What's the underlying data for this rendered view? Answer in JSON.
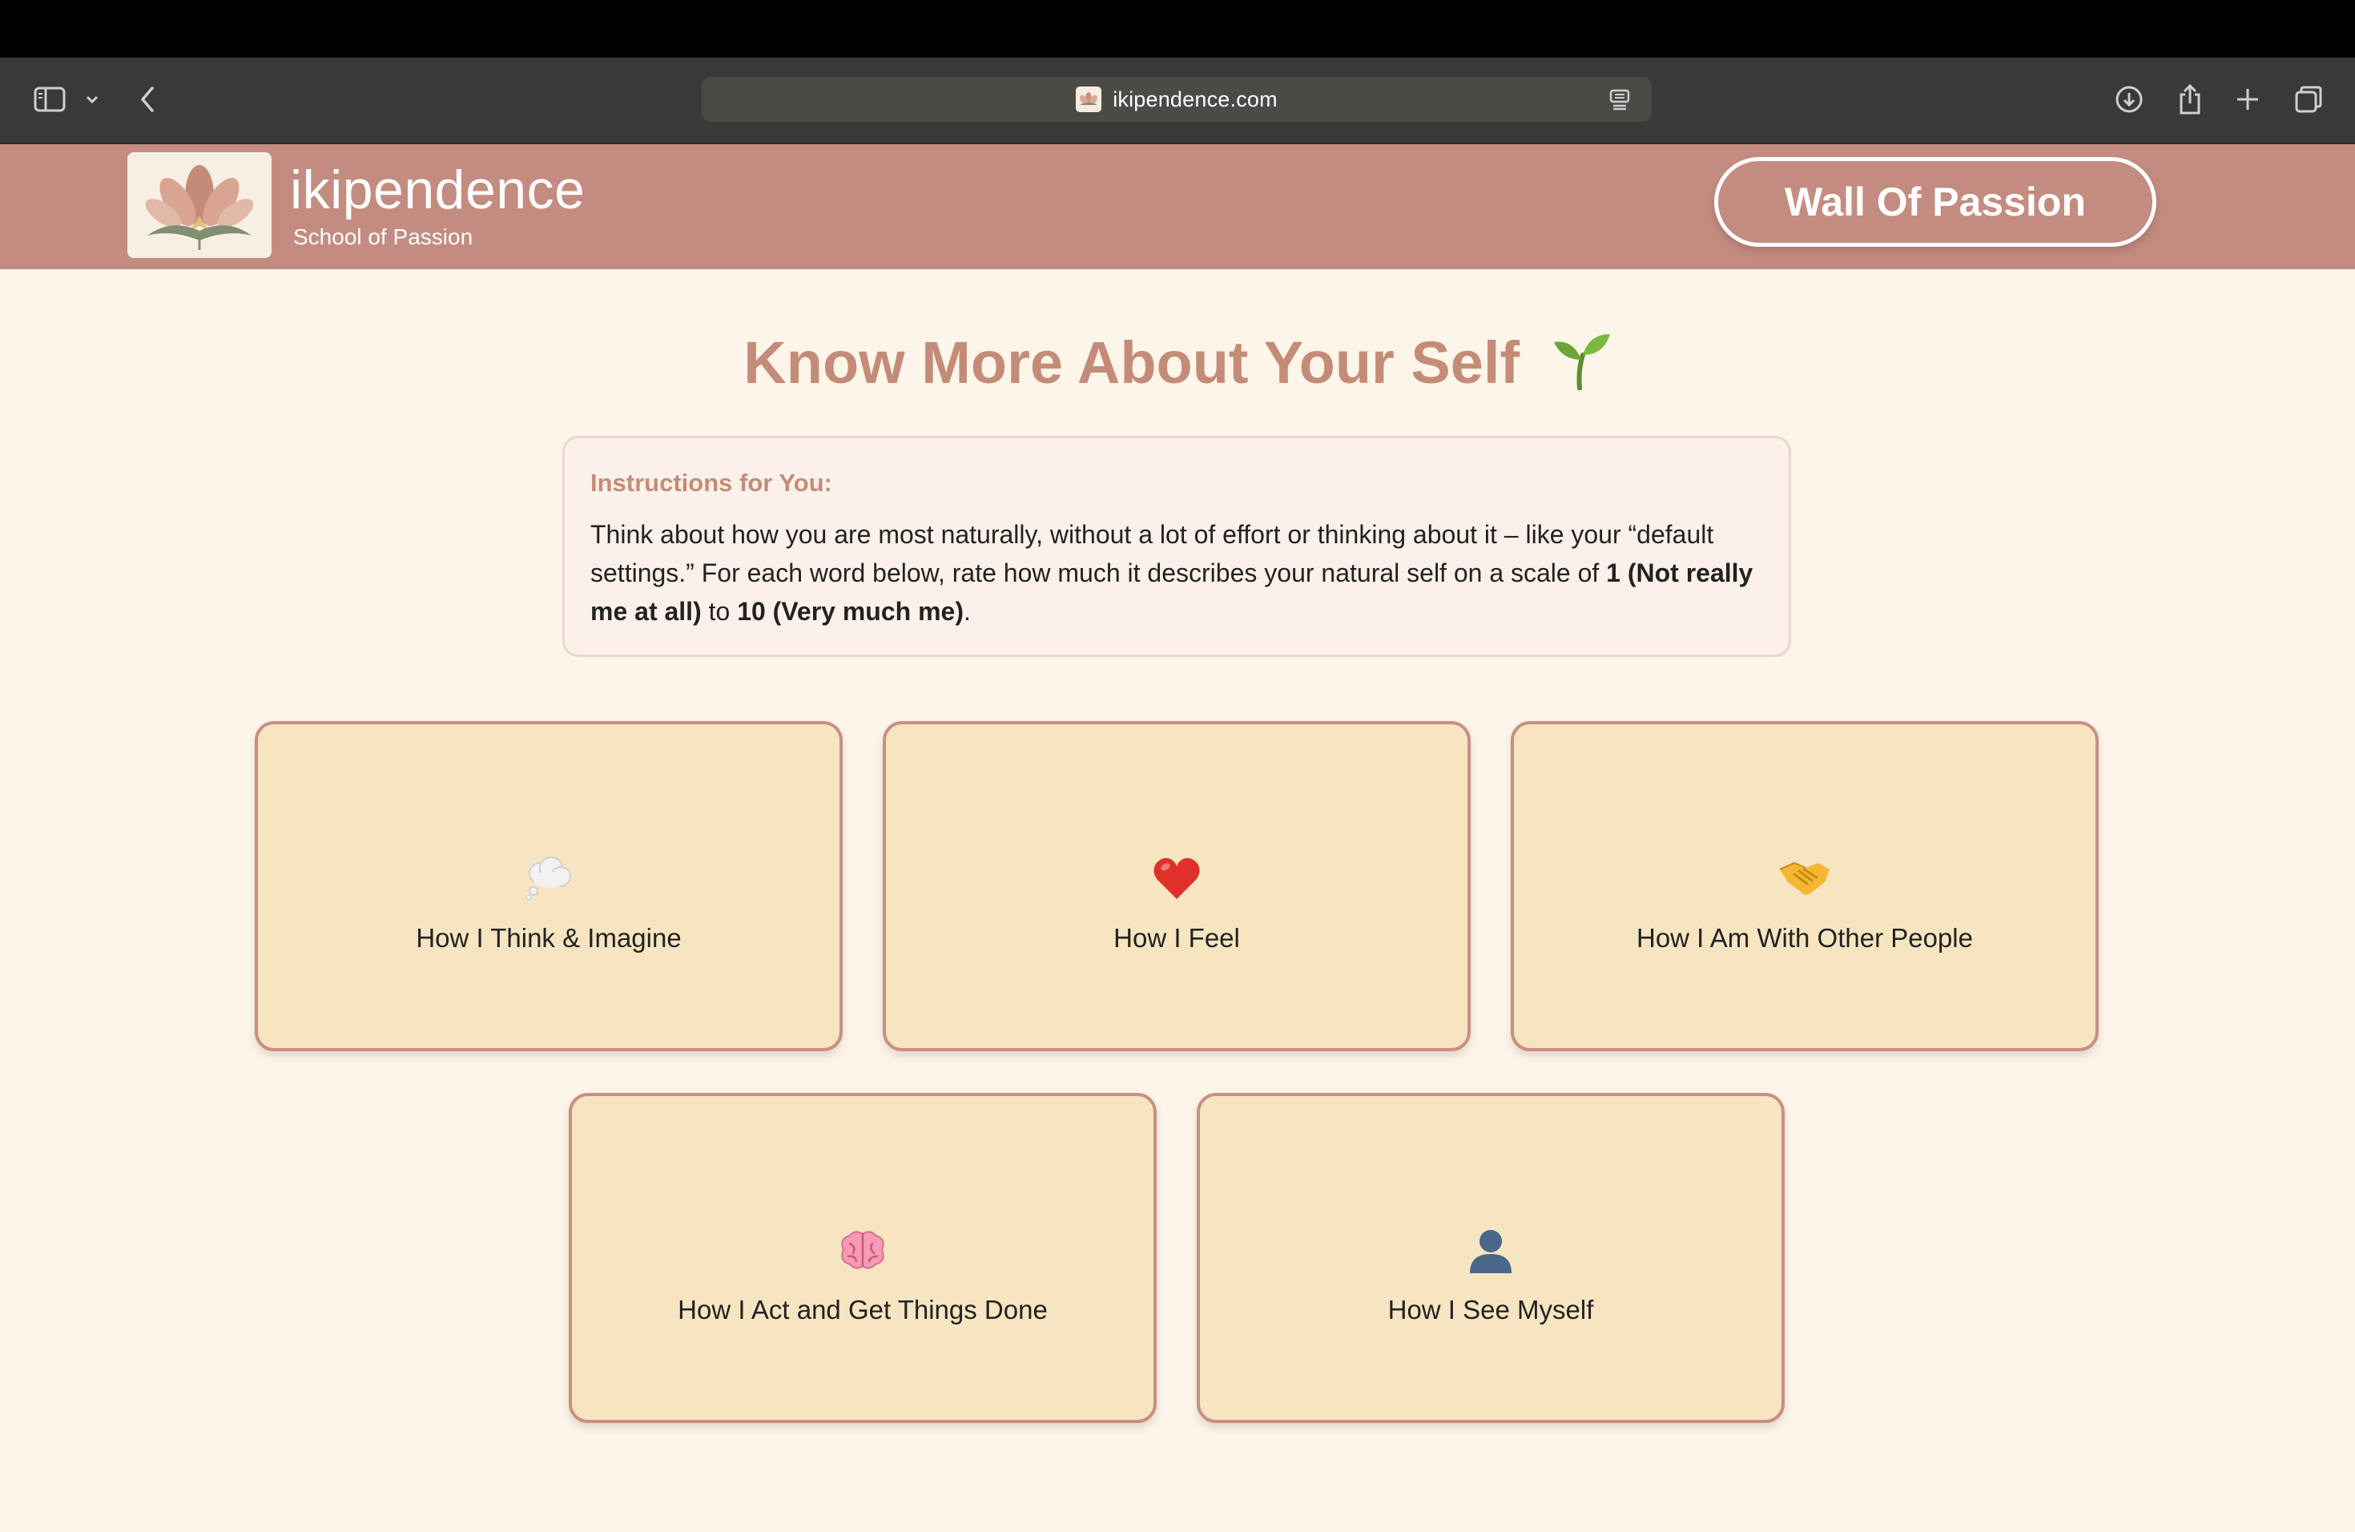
{
  "browser": {
    "url": "ikipendence.com"
  },
  "header": {
    "brand_name": "ikipendence",
    "brand_tagline": "School of Passion",
    "wall_button": "Wall Of Passion"
  },
  "main": {
    "title": "Know More About Your Self",
    "title_icon": "sprout-icon",
    "instructions": {
      "heading": "Instructions for You:",
      "text_1": "Think about how you are most naturally, without a lot of effort or thinking about it – like your “default settings.” For each word below, rate how much it describes your natural self on a scale of ",
      "bold_1": "1 (Not really me at all)",
      "text_2": " to ",
      "bold_2": "10 (Very much me)",
      "text_3": "."
    },
    "cards": [
      {
        "label": "How I Think & Imagine",
        "icon": "thought-bubble-icon"
      },
      {
        "label": "How I Feel",
        "icon": "heart-icon"
      },
      {
        "label": "How I Am With Other People",
        "icon": "handshake-icon"
      },
      {
        "label": "How I Act and Get Things Done",
        "icon": "brain-icon"
      },
      {
        "label": "How I See Myself",
        "icon": "person-silhouette-icon"
      }
    ]
  },
  "colors": {
    "header_bg": "#c48c80",
    "page_bg": "#fdf5ea",
    "accent": "#c48c78",
    "card_bg": "#f6e5c0",
    "card_border": "#c98f83"
  }
}
